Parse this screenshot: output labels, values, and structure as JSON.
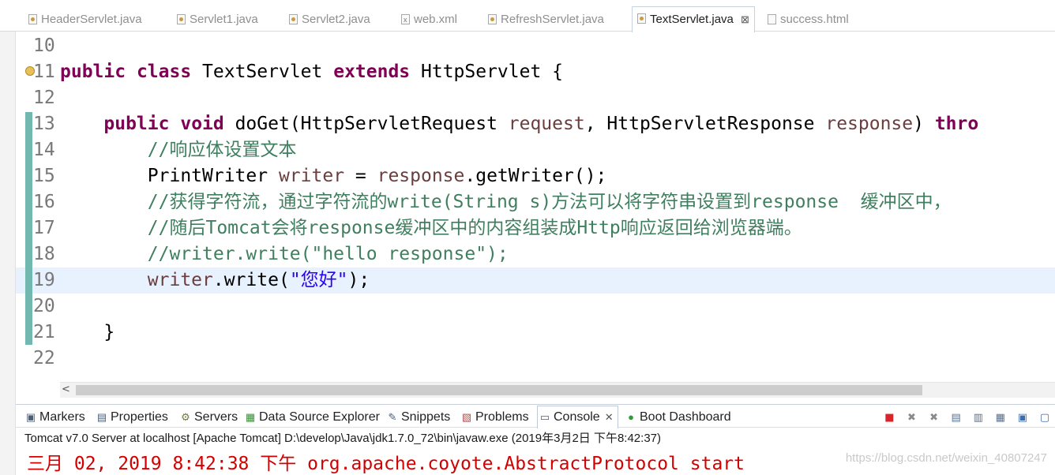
{
  "editor_tabs": [
    {
      "label": "HeaderServlet.java",
      "icon": "java-file-icon",
      "active": false
    },
    {
      "label": "Servlet1.java",
      "icon": "java-file-icon",
      "active": false
    },
    {
      "label": "Servlet2.java",
      "icon": "java-file-icon",
      "active": false
    },
    {
      "label": "web.xml",
      "icon": "xml-file-icon",
      "active": false
    },
    {
      "label": "RefreshServlet.java",
      "icon": "java-file-icon",
      "active": false
    },
    {
      "label": "TextServlet.java",
      "icon": "java-file-icon",
      "active": true,
      "close": "⊠"
    },
    {
      "label": "success.html",
      "icon": "html-file-icon",
      "active": false
    }
  ],
  "code_lines": [
    {
      "num": "10",
      "tokens": []
    },
    {
      "num": "11",
      "tokens": [
        [
          "kw",
          "public"
        ],
        [
          "pln",
          " "
        ],
        [
          "kw",
          "class"
        ],
        [
          "pln",
          " TextServlet "
        ],
        [
          "kw",
          "extends"
        ],
        [
          "pln",
          " HttpServlet {"
        ]
      ]
    },
    {
      "num": "12",
      "tokens": []
    },
    {
      "num": "13",
      "tokens": [
        [
          "pln",
          "    "
        ],
        [
          "kw",
          "public"
        ],
        [
          "pln",
          " "
        ],
        [
          "kw",
          "void"
        ],
        [
          "pln",
          " doGet(HttpServletRequest "
        ],
        [
          "var",
          "request"
        ],
        [
          "pln",
          ", HttpServletResponse "
        ],
        [
          "var",
          "response"
        ],
        [
          "pln",
          ") "
        ],
        [
          "kw",
          "thro"
        ]
      ]
    },
    {
      "num": "14",
      "tokens": [
        [
          "pln",
          "        "
        ],
        [
          "com",
          "//响应体设置文本"
        ]
      ]
    },
    {
      "num": "15",
      "tokens": [
        [
          "pln",
          "        PrintWriter "
        ],
        [
          "var",
          "writer"
        ],
        [
          "pln",
          " = "
        ],
        [
          "var",
          "response"
        ],
        [
          "pln",
          ".getWriter();"
        ]
      ]
    },
    {
      "num": "16",
      "tokens": [
        [
          "pln",
          "        "
        ],
        [
          "com",
          "//获得字符流，通过字符流的write(String s)方法可以将字符串设置到response  缓冲区中，"
        ]
      ]
    },
    {
      "num": "17",
      "tokens": [
        [
          "pln",
          "        "
        ],
        [
          "com",
          "//随后Tomcat会将response缓冲区中的内容组装成Http响应返回给浏览器端。"
        ]
      ]
    },
    {
      "num": "18",
      "tokens": [
        [
          "pln",
          "        "
        ],
        [
          "com",
          "//writer.write(\"hello response\");"
        ]
      ]
    },
    {
      "num": "19",
      "tokens": [
        [
          "pln",
          "        "
        ],
        [
          "var",
          "writer"
        ],
        [
          "pln",
          ".write("
        ],
        [
          "str",
          "\"您好\""
        ],
        [
          "pln",
          ");"
        ]
      ],
      "current": true
    },
    {
      "num": "20",
      "tokens": []
    },
    {
      "num": "21",
      "tokens": [
        [
          "pln",
          "    }"
        ]
      ]
    },
    {
      "num": "22",
      "tokens": []
    }
  ],
  "views_tabs": [
    {
      "label": "Markers",
      "icon": "markers-icon",
      "glyph": "▣",
      "active": false
    },
    {
      "label": "Properties",
      "icon": "properties-icon",
      "glyph": "▤",
      "active": false
    },
    {
      "label": "Servers",
      "icon": "servers-icon",
      "glyph": "⚙",
      "active": false
    },
    {
      "label": "Data Source Explorer",
      "icon": "data-source-icon",
      "glyph": "▦",
      "active": false
    },
    {
      "label": "Snippets",
      "icon": "snippets-icon",
      "glyph": "✎",
      "active": false
    },
    {
      "label": "Problems",
      "icon": "problems-icon",
      "glyph": "▧",
      "active": false
    },
    {
      "label": "Console",
      "icon": "console-icon",
      "glyph": "▭",
      "active": true,
      "close": "✕"
    },
    {
      "label": "Boot Dashboard",
      "icon": "boot-dashboard-icon",
      "glyph": "●",
      "active": false
    }
  ],
  "console": {
    "description": "Tomcat v7.0 Server at localhost [Apache Tomcat] D:\\develop\\Java\\jdk1.7.0_72\\bin\\javaw.exe (2019年3月2日 下午8:42:37)",
    "output_line": "三月 02, 2019 8:42:38 下午 org.apache.coyote.AbstractProtocol start"
  },
  "watermark": "https://blog.csdn.net/weixin_40807247",
  "colors": {
    "keyword": "#7f0055",
    "variable": "#6a3e3e",
    "comment": "#3f7f5f",
    "string": "#2a00ff",
    "console_error": "#d40000",
    "current_line": "#e8f2fe"
  }
}
